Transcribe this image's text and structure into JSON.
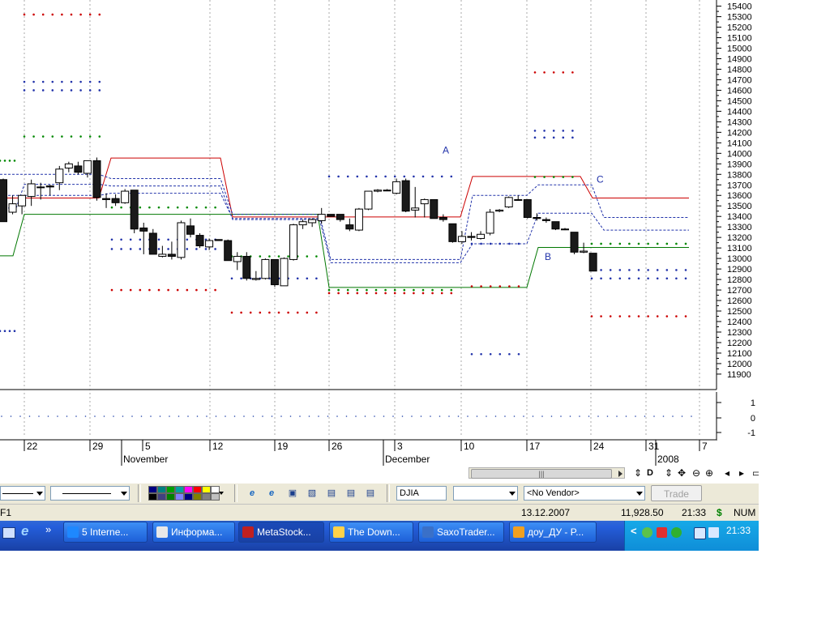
{
  "chart_data": {
    "type": "candlestick",
    "symbol": "DJIA",
    "y_ticks": [
      11900,
      12000,
      12100,
      12200,
      12300,
      12400,
      12500,
      12600,
      12700,
      12800,
      12900,
      13000,
      13100,
      13200,
      13300,
      13400,
      13500,
      13600,
      13700,
      13800,
      13900,
      14000,
      14100,
      14200,
      14300,
      14400,
      14500,
      14600,
      14700,
      14800,
      14900,
      15000,
      15100,
      15200,
      15300,
      15400
    ],
    "ylim": [
      11830,
      15420
    ],
    "indicator_ticks": [
      "1",
      "0",
      "-1"
    ],
    "x_day_labels": [
      "22",
      "29",
      "5",
      "12",
      "19",
      "26",
      "3",
      "10",
      "17",
      "24",
      "31",
      "7"
    ],
    "x_month_labels": [
      "November",
      "December",
      "2008"
    ],
    "annotations": [
      "A",
      "B",
      "C"
    ],
    "candles": [
      {
        "o": 13750,
        "h": 13760,
        "l": 13350,
        "c": 13350
      },
      {
        "o": 13440,
        "h": 13600,
        "l": 13420,
        "c": 13520
      },
      {
        "o": 13500,
        "h": 13540,
        "l": 13420,
        "c": 13600
      },
      {
        "o": 13590,
        "h": 13750,
        "l": 13500,
        "c": 13710
      },
      {
        "o": 13680,
        "h": 13720,
        "l": 13560,
        "c": 13680
      },
      {
        "o": 13690,
        "h": 13700,
        "l": 13600,
        "c": 13680
      },
      {
        "o": 13720,
        "h": 13880,
        "l": 13650,
        "c": 13850
      },
      {
        "o": 13860,
        "h": 13920,
        "l": 13820,
        "c": 13900
      },
      {
        "o": 13880,
        "h": 13920,
        "l": 13800,
        "c": 13820
      },
      {
        "o": 13810,
        "h": 13930,
        "l": 13770,
        "c": 13930
      },
      {
        "o": 13930,
        "h": 13960,
        "l": 13550,
        "c": 13580
      },
      {
        "o": 13570,
        "h": 13620,
        "l": 13480,
        "c": 13560
      },
      {
        "o": 13570,
        "h": 13610,
        "l": 13500,
        "c": 13530
      },
      {
        "o": 13530,
        "h": 13660,
        "l": 13520,
        "c": 13640
      },
      {
        "o": 13650,
        "h": 13650,
        "l": 13240,
        "c": 13280
      },
      {
        "o": 13290,
        "h": 13340,
        "l": 13040,
        "c": 13260
      },
      {
        "o": 13240,
        "h": 13280,
        "l": 13040,
        "c": 13040
      },
      {
        "o": 13020,
        "h": 13120,
        "l": 13010,
        "c": 13040
      },
      {
        "o": 13040,
        "h": 13160,
        "l": 12990,
        "c": 13020
      },
      {
        "o": 13010,
        "h": 13360,
        "l": 12990,
        "c": 13340
      },
      {
        "o": 13310,
        "h": 13380,
        "l": 13200,
        "c": 13230
      },
      {
        "o": 13220,
        "h": 13240,
        "l": 13100,
        "c": 13120
      },
      {
        "o": 13110,
        "h": 13190,
        "l": 13080,
        "c": 13170
      },
      {
        "o": 13180,
        "h": 13180,
        "l": 13170,
        "c": 13170
      },
      {
        "o": 13170,
        "h": 13180,
        "l": 12980,
        "c": 12980
      },
      {
        "o": 12970,
        "h": 13060,
        "l": 12890,
        "c": 13020
      },
      {
        "o": 13020,
        "h": 13060,
        "l": 12790,
        "c": 12810
      },
      {
        "o": 12800,
        "h": 12880,
        "l": 12790,
        "c": 12810
      },
      {
        "o": 12810,
        "h": 13000,
        "l": 12800,
        "c": 12990
      },
      {
        "o": 12990,
        "h": 12990,
        "l": 12730,
        "c": 12750
      },
      {
        "o": 12740,
        "h": 13010,
        "l": 12740,
        "c": 13000
      },
      {
        "o": 12990,
        "h": 13330,
        "l": 12980,
        "c": 13320
      },
      {
        "o": 13320,
        "h": 13370,
        "l": 13280,
        "c": 13350
      },
      {
        "o": 13340,
        "h": 13380,
        "l": 13300,
        "c": 13370
      },
      {
        "o": 13360,
        "h": 13480,
        "l": 13330,
        "c": 13420
      },
      {
        "o": 13420,
        "h": 13420,
        "l": 13400,
        "c": 13400
      },
      {
        "o": 13420,
        "h": 13420,
        "l": 13350,
        "c": 13370
      },
      {
        "o": 13320,
        "h": 13380,
        "l": 13260,
        "c": 13280
      },
      {
        "o": 13270,
        "h": 13480,
        "l": 13260,
        "c": 13470
      },
      {
        "o": 13470,
        "h": 13640,
        "l": 13460,
        "c": 13640
      },
      {
        "o": 13640,
        "h": 13660,
        "l": 13630,
        "c": 13650
      },
      {
        "o": 13650,
        "h": 13660,
        "l": 13640,
        "c": 13650
      },
      {
        "o": 13620,
        "h": 13760,
        "l": 13610,
        "c": 13730
      },
      {
        "o": 13740,
        "h": 13760,
        "l": 13440,
        "c": 13450
      },
      {
        "o": 13460,
        "h": 13680,
        "l": 13390,
        "c": 13480
      },
      {
        "o": 13520,
        "h": 13570,
        "l": 13390,
        "c": 13560
      },
      {
        "o": 13560,
        "h": 13560,
        "l": 13380,
        "c": 13380
      },
      {
        "o": 13390,
        "h": 13420,
        "l": 13350,
        "c": 13370
      },
      {
        "o": 13330,
        "h": 13330,
        "l": 13150,
        "c": 13160
      },
      {
        "o": 13160,
        "h": 13260,
        "l": 13140,
        "c": 13210
      },
      {
        "o": 13210,
        "h": 13250,
        "l": 13170,
        "c": 13200
      },
      {
        "o": 13190,
        "h": 13260,
        "l": 13180,
        "c": 13230
      },
      {
        "o": 13240,
        "h": 13470,
        "l": 13220,
        "c": 13440
      },
      {
        "o": 13450,
        "h": 13470,
        "l": 13440,
        "c": 13460
      },
      {
        "o": 13490,
        "h": 13590,
        "l": 13480,
        "c": 13580
      },
      {
        "o": 13560,
        "h": 13600,
        "l": 13550,
        "c": 13560
      },
      {
        "o": 13560,
        "h": 13560,
        "l": 13380,
        "c": 13390
      },
      {
        "o": 13390,
        "h": 13430,
        "l": 13360,
        "c": 13380
      },
      {
        "o": 13370,
        "h": 13390,
        "l": 13340,
        "c": 13360
      },
      {
        "o": 13350,
        "h": 13350,
        "l": 13270,
        "c": 13280
      },
      {
        "o": 13280,
        "h": 13290,
        "l": 13270,
        "c": 13280
      },
      {
        "o": 13250,
        "h": 13250,
        "l": 13040,
        "c": 13060
      },
      {
        "o": 13060,
        "h": 13150,
        "l": 13050,
        "c": 13070
      },
      {
        "o": 13050,
        "h": 13050,
        "l": 12880,
        "c": 12880
      }
    ]
  },
  "toolbar": {
    "symbol_value": "DJIA",
    "vendor_value": "<No Vendor>",
    "trade_label": "Trade",
    "palette_colors": [
      "#000080",
      "#008080",
      "#00a000",
      "#00a0a0",
      "#ff00ff",
      "#ff0000",
      "#ffff00",
      "#ffffff",
      "#000000",
      "#404080",
      "#008000",
      "#8080ff",
      "#000080",
      "#808000",
      "#808080",
      "#c0c0c0"
    ]
  },
  "status_bar": {
    "left_text": "F1",
    "date": "13.12.2007",
    "value": "11,928.50",
    "time": "21:33",
    "dollar": "$",
    "num": "NUM"
  },
  "taskbar": {
    "show_more": "»",
    "tray_time": "21:33",
    "tray_arrow": "<",
    "items": [
      {
        "label": "5 Interne...",
        "color": "#1e88ff"
      },
      {
        "label": "Информа...",
        "color": "#e8e8e8"
      },
      {
        "label": "MetaStock...",
        "color": "#c02020"
      },
      {
        "label": "The Down...",
        "color": "#ffd24a"
      },
      {
        "label": "SaxoTrader...",
        "color": "#3a70c8"
      },
      {
        "label": "доу_ДУ - P...",
        "color": "#f0a020"
      }
    ]
  }
}
